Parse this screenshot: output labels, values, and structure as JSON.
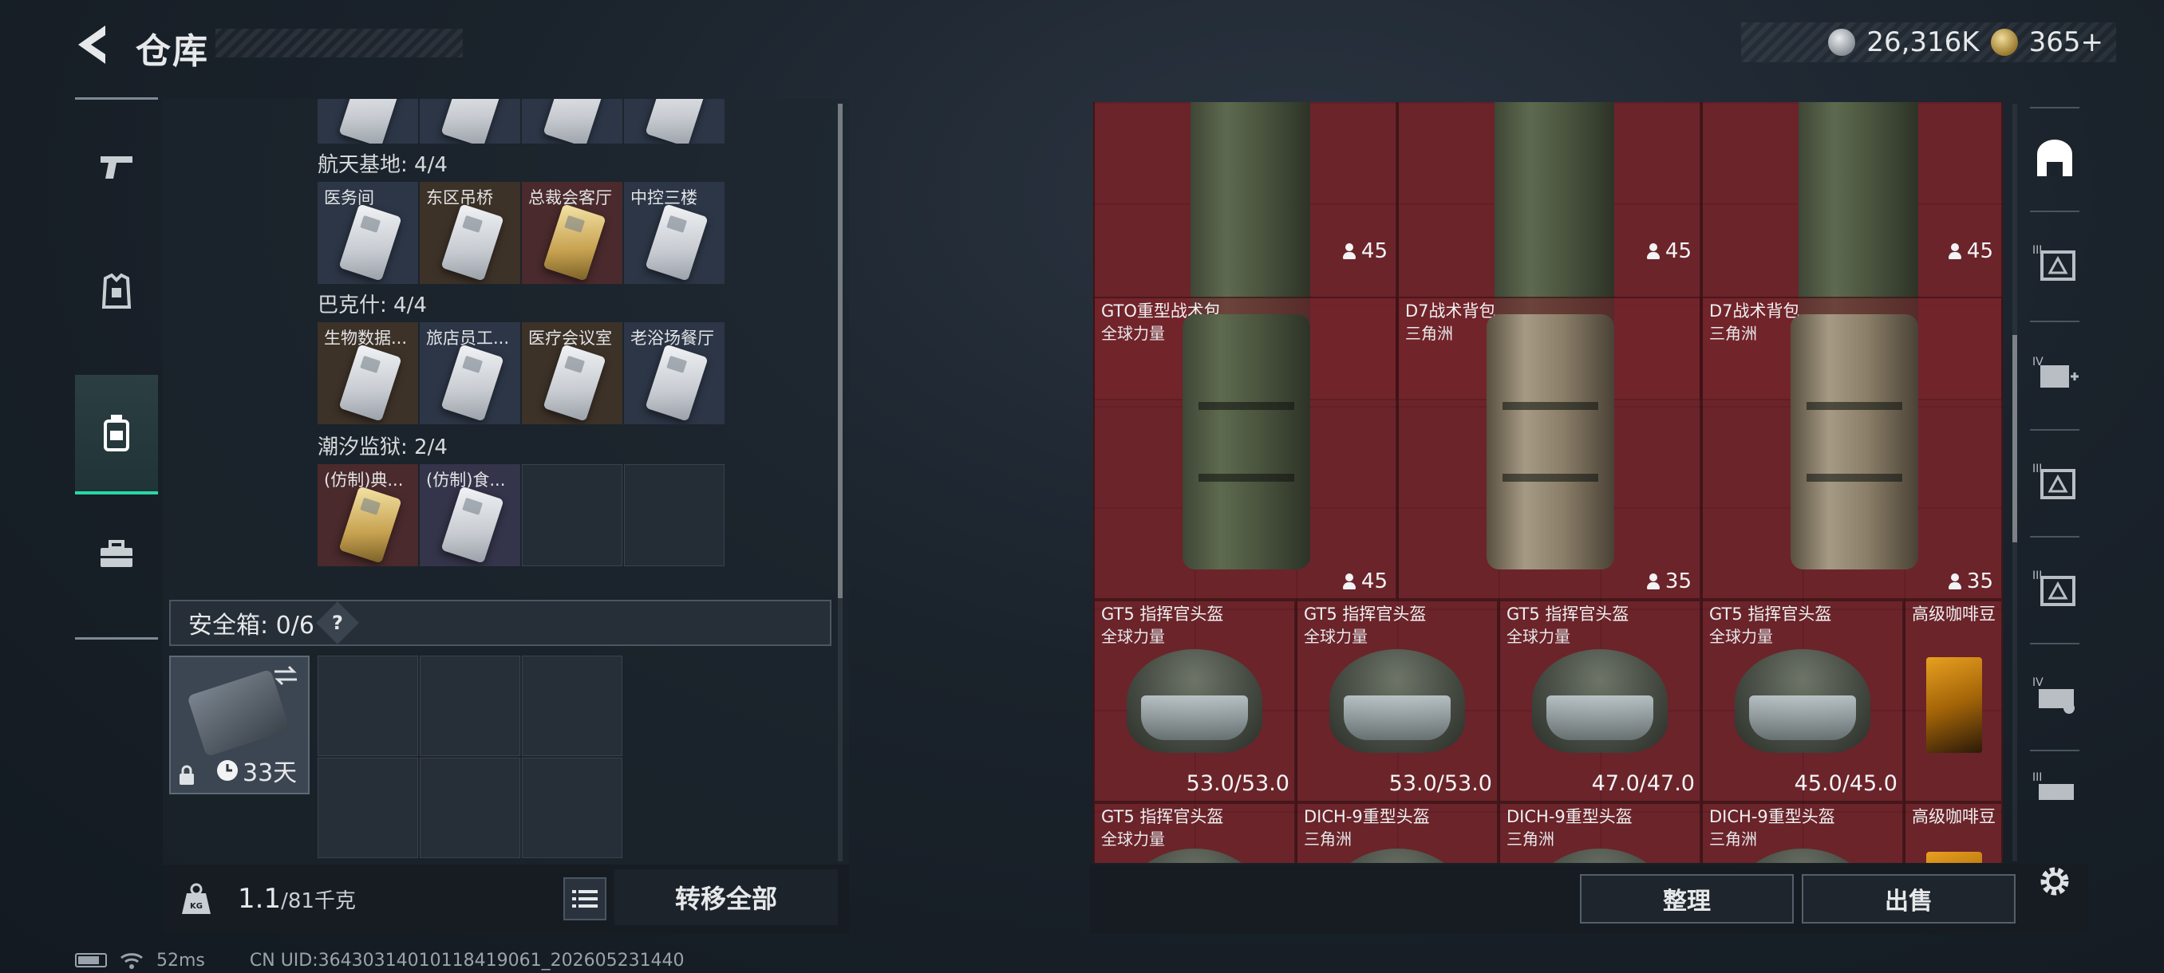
{
  "header": {
    "title": "仓库",
    "currency_primary": "26,316K",
    "currency_secondary": "365+"
  },
  "left_nav": [
    "gun-icon",
    "armor-icon",
    "backpack-icon",
    "toolbox-icon"
  ],
  "key_groups": [
    {
      "label": "航天基地: 4/4",
      "cards": [
        {
          "name": "医务间",
          "variant": "blue"
        },
        {
          "name": "东区吊桥",
          "variant": "brown"
        },
        {
          "name": "总裁会客厅",
          "variant": "red"
        },
        {
          "name": "中控三楼",
          "variant": "blue"
        }
      ]
    },
    {
      "label": "巴克什: 4/4",
      "cards": [
        {
          "name": "生物数据...",
          "variant": "brown"
        },
        {
          "name": "旅店员工...",
          "variant": "blue"
        },
        {
          "name": "医疗会议室",
          "variant": "brown"
        },
        {
          "name": "老浴场餐厅",
          "variant": "blue"
        }
      ]
    },
    {
      "label": "潮汐监狱: 2/4",
      "cards": [
        {
          "name": "(仿制)典...",
          "variant": "red"
        },
        {
          "name": "(仿制)食...",
          "variant": "purple"
        }
      ]
    }
  ],
  "safe_box": {
    "label": "安全箱: 0/6",
    "help": "?",
    "duration": "33天"
  },
  "weight": {
    "current": "1.1",
    "capacity": "/81千克"
  },
  "transfer_all": "转移全部",
  "stash_items": [
    {
      "name": "",
      "sub": "",
      "level": "45",
      "type": "bp-green"
    },
    {
      "name": "",
      "sub": "",
      "level": "45",
      "type": "bp-green"
    },
    {
      "name": "",
      "sub": "",
      "level": "45",
      "type": "bp-green"
    },
    {
      "name": "GTO重型战术包",
      "sub": "全球力量",
      "level": "45",
      "type": "bp-green"
    },
    {
      "name": "D7战术背包",
      "sub": "三角洲",
      "level": "35",
      "type": "bp-tan"
    },
    {
      "name": "D7战术背包",
      "sub": "三角洲",
      "level": "35",
      "type": "bp-tan"
    },
    {
      "name": "GT5 指挥官头盔",
      "sub": "全球力量",
      "durability": "53.0/53.0"
    },
    {
      "name": "GT5 指挥官头盔",
      "sub": "全球力量",
      "durability": "53.0/53.0"
    },
    {
      "name": "GT5 指挥官头盔",
      "sub": "全球力量",
      "durability": "47.0/47.0"
    },
    {
      "name": "GT5 指挥官头盔",
      "sub": "全球力量",
      "durability": "45.0/45.0"
    },
    {
      "name": "高级咖啡豆",
      "sub": ""
    },
    {
      "name": "GT5 指挥官头盔",
      "sub": "全球力量"
    },
    {
      "name": "DICH-9重型头盔",
      "sub": "三角洲"
    },
    {
      "name": "DICH-9重型头盔",
      "sub": "三角洲"
    },
    {
      "name": "DICH-9重型头盔",
      "sub": "三角洲"
    },
    {
      "name": "高级咖啡豆",
      "sub": ""
    }
  ],
  "actions": {
    "organize": "整理",
    "sell": "出售"
  },
  "right_nav": [
    "stash-icon",
    "tier3-backpack-icon",
    "tier4-medkit-icon",
    "tier3-backpack-icon",
    "tier3-backpack-icon",
    "tier4-rig-icon",
    "tier3-rig-icon"
  ],
  "status_bar": {
    "ping": "52ms",
    "uid": "CN UID:364303140101184190​61_202605231440"
  }
}
